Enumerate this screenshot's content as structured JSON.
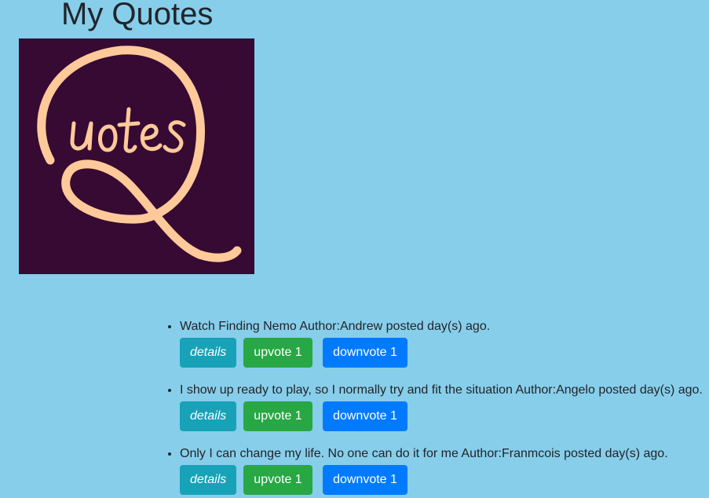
{
  "header": {
    "title": "My Quotes"
  },
  "logo": {
    "alt": "Quotes logo",
    "text": "uotes",
    "background": "#360a32",
    "stroke": "#ffc99a"
  },
  "quotes": [
    {
      "text": "Watch Finding Nemo Author:Andrew posted day(s) ago.",
      "details_label": "details",
      "upvote_label": "upvote 1",
      "downvote_label": "downvote 1"
    },
    {
      "text": "I show up ready to play, so I normally try and fit the situation Author:Angelo posted day(s) ago.",
      "details_label": "details",
      "upvote_label": "upvote 1",
      "downvote_label": "downvote 1"
    },
    {
      "text": "Only I can change my life. No one can do it for me Author:Franmcois posted day(s) ago.",
      "details_label": "details",
      "upvote_label": "upvote 1",
      "downvote_label": "downvote 1"
    }
  ],
  "colors": {
    "page_background": "#87ceeb",
    "details": "#17a2b8",
    "upvote": "#28a745",
    "downvote": "#007bff"
  }
}
